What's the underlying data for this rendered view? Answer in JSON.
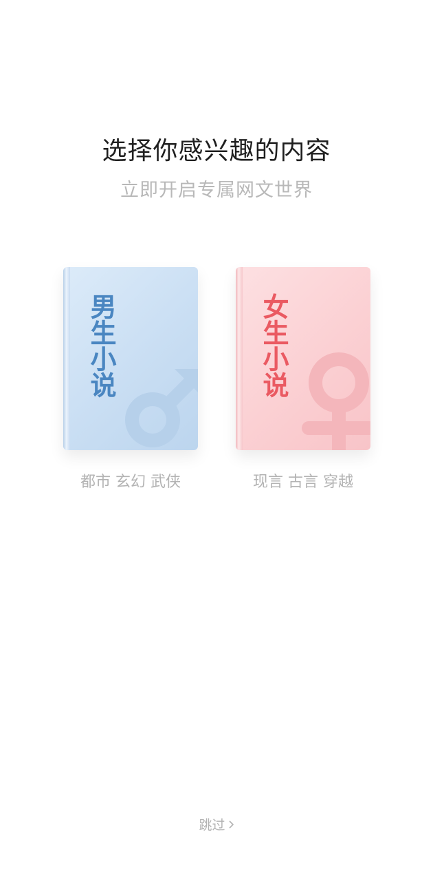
{
  "header": {
    "title": "选择你感兴趣的内容",
    "subtitle": "立即开启专属网文世界"
  },
  "options": {
    "male": {
      "cover_text": "男生小说",
      "tags": "都市 玄幻 武侠",
      "text_color": "#4a86c1",
      "icon": "male-symbol-icon"
    },
    "female": {
      "cover_text": "女生小说",
      "tags": "现言 古言 穿越",
      "text_color": "#ea5a62",
      "icon": "female-symbol-icon"
    }
  },
  "footer": {
    "skip_label": "跳过",
    "skip_icon": "chevron-right-icon"
  }
}
